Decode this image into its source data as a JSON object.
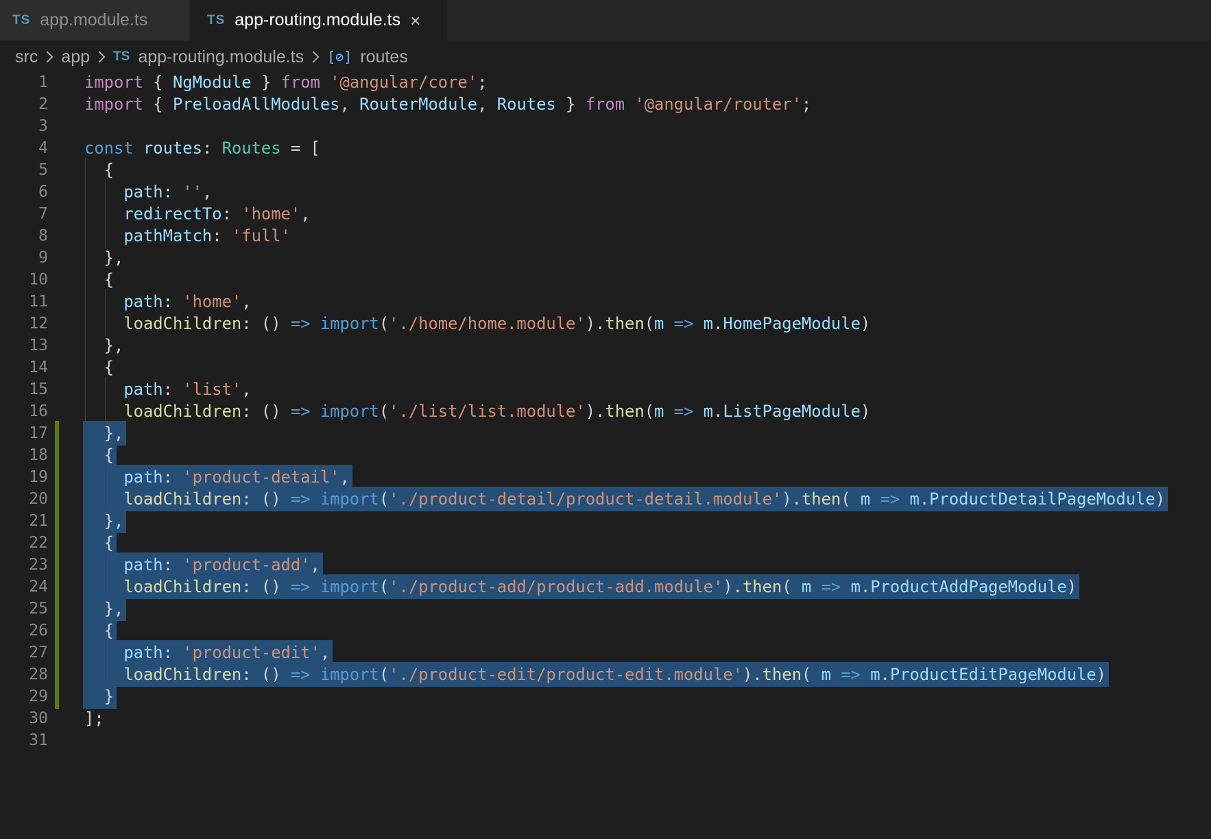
{
  "tabs": [
    {
      "icon_text": "TS",
      "label": "app.module.ts",
      "active": false
    },
    {
      "icon_text": "TS",
      "label": "app-routing.module.ts",
      "active": true,
      "close": "×"
    }
  ],
  "breadcrumb": {
    "items": [
      "src",
      "app"
    ],
    "file_icon_text": "TS",
    "file": "app-routing.module.ts",
    "symbol_icon": "symbol-variable-icon",
    "symbol": "routes"
  },
  "editor": {
    "language": "TypeScript",
    "lines": [
      {
        "n": "1",
        "s": false,
        "t": [
          [
            "import",
            "kw"
          ],
          [
            " { ",
            "pl"
          ],
          [
            "NgModule",
            "var"
          ],
          [
            " } ",
            "pl"
          ],
          [
            "from",
            "kw"
          ],
          [
            " ",
            "pl"
          ],
          [
            "'@angular/core'",
            "str"
          ],
          [
            ";",
            "pl"
          ]
        ]
      },
      {
        "n": "2",
        "s": false,
        "t": [
          [
            "import",
            "kw"
          ],
          [
            " { ",
            "pl"
          ],
          [
            "PreloadAllModules",
            "var"
          ],
          [
            ", ",
            "pl"
          ],
          [
            "RouterModule",
            "var"
          ],
          [
            ", ",
            "pl"
          ],
          [
            "Routes",
            "var"
          ],
          [
            " } ",
            "pl"
          ],
          [
            "from",
            "kw"
          ],
          [
            " ",
            "pl"
          ],
          [
            "'@angular/router'",
            "str"
          ],
          [
            ";",
            "pl"
          ]
        ]
      },
      {
        "n": "3",
        "s": false,
        "t": []
      },
      {
        "n": "4",
        "s": false,
        "t": [
          [
            "const",
            "kw2"
          ],
          [
            " ",
            "pl"
          ],
          [
            "routes",
            "var"
          ],
          [
            ": ",
            "pl"
          ],
          [
            "Routes",
            "typ"
          ],
          [
            " = [",
            "pl"
          ]
        ]
      },
      {
        "n": "5",
        "s": false,
        "t": [
          [
            "  {",
            "pl"
          ]
        ]
      },
      {
        "n": "6",
        "s": false,
        "t": [
          [
            "    ",
            "pl"
          ],
          [
            "path",
            "var"
          ],
          [
            ": ",
            "pl"
          ],
          [
            "''",
            "str"
          ],
          [
            ",",
            "pl"
          ]
        ]
      },
      {
        "n": "7",
        "s": false,
        "t": [
          [
            "    ",
            "pl"
          ],
          [
            "redirectTo",
            "var"
          ],
          [
            ": ",
            "pl"
          ],
          [
            "'home'",
            "str"
          ],
          [
            ",",
            "pl"
          ]
        ]
      },
      {
        "n": "8",
        "s": false,
        "t": [
          [
            "    ",
            "pl"
          ],
          [
            "pathMatch",
            "var"
          ],
          [
            ": ",
            "pl"
          ],
          [
            "'full'",
            "str"
          ]
        ]
      },
      {
        "n": "9",
        "s": false,
        "t": [
          [
            "  },",
            "pl"
          ]
        ]
      },
      {
        "n": "10",
        "s": false,
        "t": [
          [
            "  {",
            "pl"
          ]
        ]
      },
      {
        "n": "11",
        "s": false,
        "t": [
          [
            "    ",
            "pl"
          ],
          [
            "path",
            "var"
          ],
          [
            ": ",
            "pl"
          ],
          [
            "'home'",
            "str"
          ],
          [
            ",",
            "pl"
          ]
        ]
      },
      {
        "n": "12",
        "s": false,
        "t": [
          [
            "    ",
            "pl"
          ],
          [
            "loadChildren",
            "fn"
          ],
          [
            ": () ",
            "pl"
          ],
          [
            "=>",
            "kw2"
          ],
          [
            " ",
            "pl"
          ],
          [
            "import",
            "kw2"
          ],
          [
            "(",
            "pl"
          ],
          [
            "'./home/home.module'",
            "str"
          ],
          [
            ").",
            "pl"
          ],
          [
            "then",
            "fn"
          ],
          [
            "(",
            "pl"
          ],
          [
            "m",
            "var"
          ],
          [
            " ",
            "pl"
          ],
          [
            "=>",
            "kw2"
          ],
          [
            " ",
            "pl"
          ],
          [
            "m",
            "var"
          ],
          [
            ".",
            "pl"
          ],
          [
            "HomePageModule",
            "var"
          ],
          [
            ")",
            "pl"
          ]
        ]
      },
      {
        "n": "13",
        "s": false,
        "t": [
          [
            "  },",
            "pl"
          ]
        ]
      },
      {
        "n": "14",
        "s": false,
        "t": [
          [
            "  {",
            "pl"
          ]
        ]
      },
      {
        "n": "15",
        "s": false,
        "t": [
          [
            "    ",
            "pl"
          ],
          [
            "path",
            "var"
          ],
          [
            ": ",
            "pl"
          ],
          [
            "'list'",
            "str"
          ],
          [
            ",",
            "pl"
          ]
        ]
      },
      {
        "n": "16",
        "s": false,
        "t": [
          [
            "    ",
            "pl"
          ],
          [
            "loadChildren",
            "fn"
          ],
          [
            ": () ",
            "pl"
          ],
          [
            "=>",
            "kw2"
          ],
          [
            " ",
            "pl"
          ],
          [
            "import",
            "kw2"
          ],
          [
            "(",
            "pl"
          ],
          [
            "'./list/list.module'",
            "str"
          ],
          [
            ").",
            "pl"
          ],
          [
            "then",
            "fn"
          ],
          [
            "(",
            "pl"
          ],
          [
            "m",
            "var"
          ],
          [
            " ",
            "pl"
          ],
          [
            "=>",
            "kw2"
          ],
          [
            " ",
            "pl"
          ],
          [
            "m",
            "var"
          ],
          [
            ".",
            "pl"
          ],
          [
            "ListPageModule",
            "var"
          ],
          [
            ")",
            "pl"
          ]
        ]
      },
      {
        "n": "17",
        "s": true,
        "t": [
          [
            "  },",
            "pl"
          ]
        ]
      },
      {
        "n": "18",
        "s": true,
        "t": [
          [
            "  {",
            "pl"
          ]
        ]
      },
      {
        "n": "19",
        "s": true,
        "t": [
          [
            "    ",
            "pl"
          ],
          [
            "path",
            "var"
          ],
          [
            ": ",
            "pl"
          ],
          [
            "'product-detail'",
            "str"
          ],
          [
            ",",
            "pl"
          ]
        ]
      },
      {
        "n": "20",
        "s": true,
        "t": [
          [
            "    ",
            "pl"
          ],
          [
            "loadChildren",
            "fn"
          ],
          [
            ": () ",
            "pl"
          ],
          [
            "=>",
            "kw2"
          ],
          [
            " ",
            "pl"
          ],
          [
            "import",
            "kw2"
          ],
          [
            "(",
            "pl"
          ],
          [
            "'./product-detail/product-detail.module'",
            "str"
          ],
          [
            ").",
            "pl"
          ],
          [
            "then",
            "fn"
          ],
          [
            "( ",
            "pl"
          ],
          [
            "m",
            "var"
          ],
          [
            " ",
            "pl"
          ],
          [
            "=>",
            "kw2"
          ],
          [
            " ",
            "pl"
          ],
          [
            "m",
            "var"
          ],
          [
            ".",
            "pl"
          ],
          [
            "ProductDetailPageModule",
            "var"
          ],
          [
            ")",
            "pl"
          ]
        ]
      },
      {
        "n": "21",
        "s": true,
        "t": [
          [
            "  },",
            "pl"
          ]
        ]
      },
      {
        "n": "22",
        "s": true,
        "t": [
          [
            "  {",
            "pl"
          ]
        ]
      },
      {
        "n": "23",
        "s": true,
        "t": [
          [
            "    ",
            "pl"
          ],
          [
            "path",
            "var"
          ],
          [
            ": ",
            "pl"
          ],
          [
            "'product-add'",
            "str"
          ],
          [
            ",",
            "pl"
          ]
        ]
      },
      {
        "n": "24",
        "s": true,
        "t": [
          [
            "    ",
            "pl"
          ],
          [
            "loadChildren",
            "fn"
          ],
          [
            ": () ",
            "pl"
          ],
          [
            "=>",
            "kw2"
          ],
          [
            " ",
            "pl"
          ],
          [
            "import",
            "kw2"
          ],
          [
            "(",
            "pl"
          ],
          [
            "'./product-add/product-add.module'",
            "str"
          ],
          [
            ").",
            "pl"
          ],
          [
            "then",
            "fn"
          ],
          [
            "( ",
            "pl"
          ],
          [
            "m",
            "var"
          ],
          [
            " ",
            "pl"
          ],
          [
            "=>",
            "kw2"
          ],
          [
            " ",
            "pl"
          ],
          [
            "m",
            "var"
          ],
          [
            ".",
            "pl"
          ],
          [
            "ProductAddPageModule",
            "var"
          ],
          [
            ")",
            "pl"
          ]
        ]
      },
      {
        "n": "25",
        "s": true,
        "t": [
          [
            "  },",
            "pl"
          ]
        ]
      },
      {
        "n": "26",
        "s": true,
        "t": [
          [
            "  {",
            "pl"
          ]
        ]
      },
      {
        "n": "27",
        "s": true,
        "t": [
          [
            "    ",
            "pl"
          ],
          [
            "path",
            "var"
          ],
          [
            ": ",
            "pl"
          ],
          [
            "'product-edit'",
            "str"
          ],
          [
            ",",
            "pl"
          ]
        ]
      },
      {
        "n": "28",
        "s": true,
        "t": [
          [
            "    ",
            "pl"
          ],
          [
            "loadChildren",
            "fn"
          ],
          [
            ": () ",
            "pl"
          ],
          [
            "=>",
            "kw2"
          ],
          [
            " ",
            "pl"
          ],
          [
            "import",
            "kw2"
          ],
          [
            "(",
            "pl"
          ],
          [
            "'./product-edit/product-edit.module'",
            "str"
          ],
          [
            ").",
            "pl"
          ],
          [
            "then",
            "fn"
          ],
          [
            "( ",
            "pl"
          ],
          [
            "m",
            "var"
          ],
          [
            " ",
            "pl"
          ],
          [
            "=>",
            "kw2"
          ],
          [
            " ",
            "pl"
          ],
          [
            "m",
            "var"
          ],
          [
            ".",
            "pl"
          ],
          [
            "ProductEditPageModule",
            "var"
          ],
          [
            ")",
            "pl"
          ]
        ]
      },
      {
        "n": "29",
        "s": true,
        "t": [
          [
            "  }",
            "pl"
          ]
        ]
      },
      {
        "n": "30",
        "s": false,
        "t": [
          [
            "];",
            "pl"
          ]
        ]
      },
      {
        "n": "31",
        "s": false,
        "t": []
      }
    ]
  },
  "colors": {
    "background": "#1e1e1e",
    "selection": "#264f78",
    "gutter_modified": "#587c0c",
    "keyword": "#c586c0",
    "storage": "#569cd6",
    "variable": "#9cdcfe",
    "type": "#4ec9b0",
    "string": "#ce9178",
    "function": "#dcdcaa"
  }
}
